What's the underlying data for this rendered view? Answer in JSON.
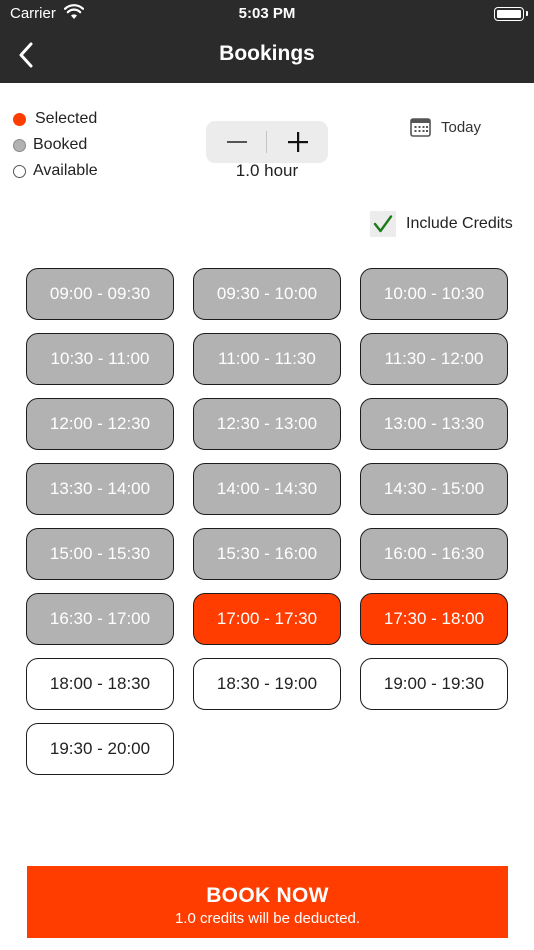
{
  "status_bar": {
    "carrier": "Carrier",
    "time": "5:03 PM"
  },
  "nav": {
    "title": "Bookings"
  },
  "legend": {
    "selected": "Selected",
    "booked": "Booked",
    "available": "Available"
  },
  "duration": {
    "value": "1.0 hour"
  },
  "today_label": "Today",
  "include_credits": {
    "label": "Include Credits",
    "checked": true
  },
  "slots": [
    {
      "label": "09:00 - 09:30",
      "state": "booked"
    },
    {
      "label": "09:30 - 10:00",
      "state": "booked"
    },
    {
      "label": "10:00 - 10:30",
      "state": "booked"
    },
    {
      "label": "10:30 - 11:00",
      "state": "booked"
    },
    {
      "label": "11:00 - 11:30",
      "state": "booked"
    },
    {
      "label": "11:30 - 12:00",
      "state": "booked"
    },
    {
      "label": "12:00 - 12:30",
      "state": "booked"
    },
    {
      "label": "12:30 - 13:00",
      "state": "booked"
    },
    {
      "label": "13:00 - 13:30",
      "state": "booked"
    },
    {
      "label": "13:30 - 14:00",
      "state": "booked"
    },
    {
      "label": "14:00 - 14:30",
      "state": "booked"
    },
    {
      "label": "14:30 - 15:00",
      "state": "booked"
    },
    {
      "label": "15:00 - 15:30",
      "state": "booked"
    },
    {
      "label": "15:30 - 16:00",
      "state": "booked"
    },
    {
      "label": "16:00 - 16:30",
      "state": "booked"
    },
    {
      "label": "16:30 - 17:00",
      "state": "booked"
    },
    {
      "label": "17:00 - 17:30",
      "state": "selected"
    },
    {
      "label": "17:30 - 18:00",
      "state": "selected"
    },
    {
      "label": "18:00 - 18:30",
      "state": "available"
    },
    {
      "label": "18:30 - 19:00",
      "state": "available"
    },
    {
      "label": "19:00 - 19:30",
      "state": "available"
    },
    {
      "label": "19:30 - 20:00",
      "state": "available"
    }
  ],
  "book_now": {
    "label": "BOOK NOW",
    "note": "1.0 credits will be deducted."
  },
  "colors": {
    "accent": "#ff3d00",
    "booked": "#b2b2b2",
    "header": "#2b2b2b",
    "check": "#1b7a1b"
  },
  "icons": {
    "back": "chevron-left-icon",
    "minus": "minus-icon",
    "plus": "plus-icon",
    "calendar": "calendar-icon",
    "check": "checkmark-icon",
    "wifi": "wifi-icon",
    "battery": "battery-icon"
  }
}
